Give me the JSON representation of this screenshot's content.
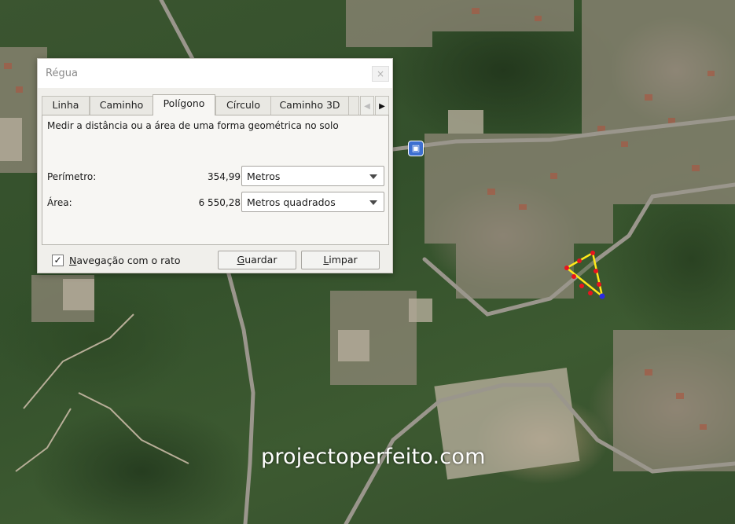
{
  "dialog": {
    "title": "Régua",
    "close_glyph": "×",
    "tabs": [
      {
        "label": "Linha",
        "active": false
      },
      {
        "label": "Caminho",
        "active": false
      },
      {
        "label": "Polígono",
        "active": true
      },
      {
        "label": "Círculo",
        "active": false
      },
      {
        "label": "Caminho 3D",
        "active": false
      }
    ],
    "description": "Medir a distância ou a área de uma forma geométrica no solo",
    "perimeter": {
      "label": "Perímetro:",
      "value": "354,99",
      "unit": "Metros"
    },
    "area": {
      "label": "Área:",
      "value": "6 550,28",
      "unit": "Metros quadrados"
    },
    "mouse_nav": {
      "label_first": "N",
      "label_rest": "avegação com o rato",
      "checked": true
    },
    "save_button": {
      "first": "G",
      "rest": "uardar"
    },
    "clear_button": {
      "first": "L",
      "rest": "impar"
    }
  },
  "map": {
    "watermark": "projectoperfeito.com",
    "bus_stop_icon": "bus-stop-icon",
    "polygon_edge_color": "#ffe81a",
    "vertex_color": "#e8141e",
    "last_vertex_color": "#2a2ae0"
  }
}
